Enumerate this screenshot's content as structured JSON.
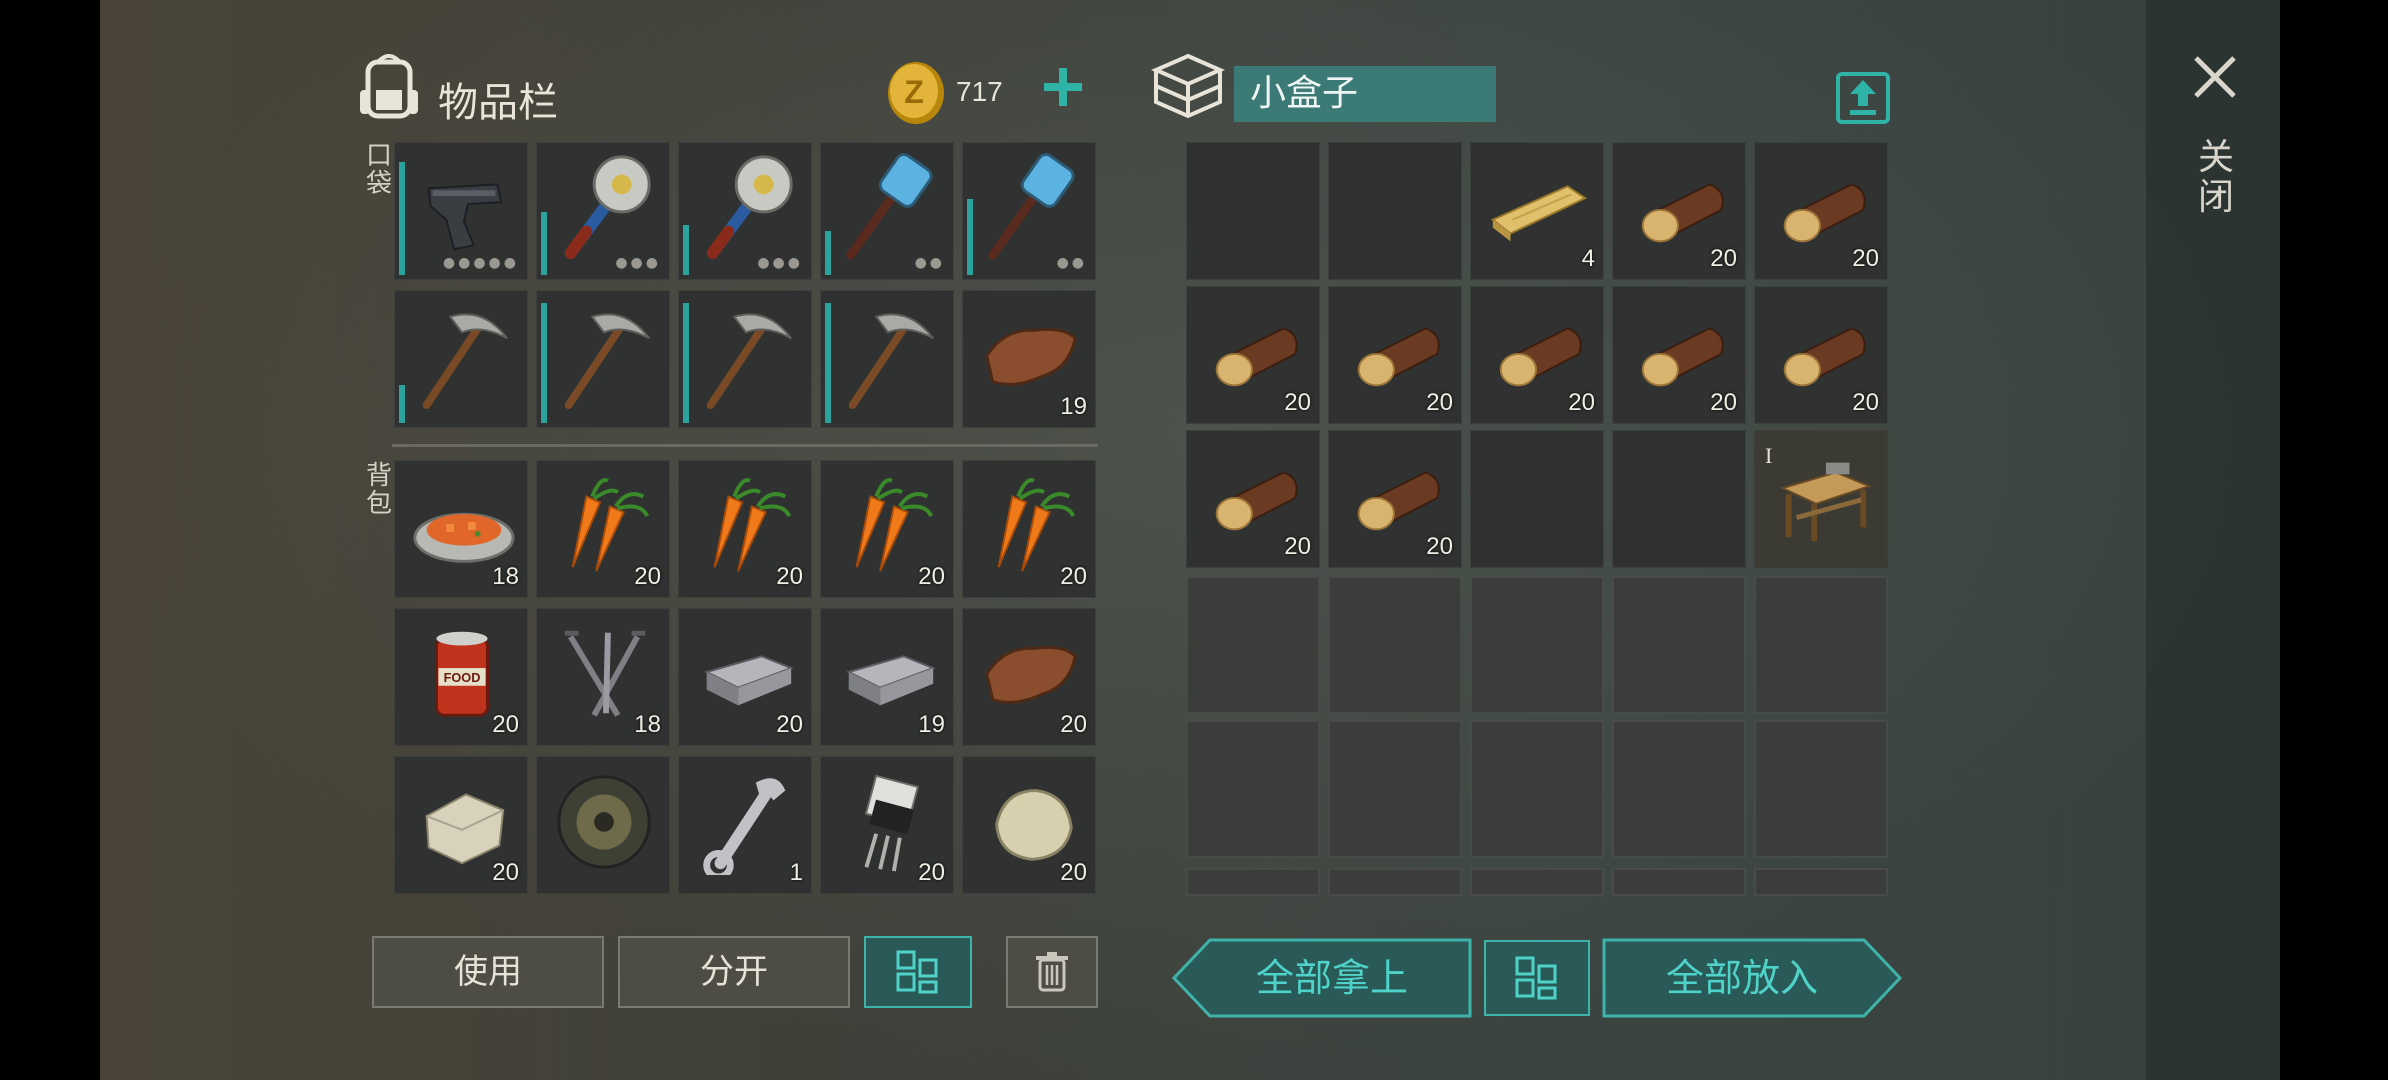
{
  "inventory": {
    "title": "物品栏",
    "pocket_label": "口袋",
    "backpack_label": "背包"
  },
  "currency": {
    "amount": "717"
  },
  "container": {
    "name": "小盒子"
  },
  "close_label": "关闭",
  "pocket": [
    {
      "icon": "pistol-icon",
      "qty": "",
      "dur": 0.9,
      "dots": "●●●●●"
    },
    {
      "icon": "saw-mace-icon",
      "qty": "",
      "dur": 0.5,
      "dots": "●●●"
    },
    {
      "icon": "saw-mace-icon",
      "qty": "",
      "dur": 0.4,
      "dots": "●●●"
    },
    {
      "icon": "sledgehammer-icon",
      "qty": "",
      "dur": 0.35,
      "dots": "●●"
    },
    {
      "icon": "sledgehammer-icon",
      "qty": "",
      "dur": 0.6,
      "dots": "●●"
    },
    {
      "icon": "pickaxe-icon",
      "qty": "",
      "dur": 0.3,
      "dots": ""
    },
    {
      "icon": "pickaxe-icon",
      "qty": "",
      "dur": 0.95,
      "dots": ""
    },
    {
      "icon": "pickaxe-icon",
      "qty": "",
      "dur": 0.95,
      "dots": ""
    },
    {
      "icon": "pickaxe-icon",
      "qty": "",
      "dur": 0.95,
      "dots": ""
    },
    {
      "icon": "leather-icon",
      "qty": "19",
      "dur": 0,
      "dots": ""
    }
  ],
  "backpack": [
    {
      "icon": "carrot-dish-icon",
      "qty": "18"
    },
    {
      "icon": "carrot-icon",
      "qty": "20"
    },
    {
      "icon": "carrot-icon",
      "qty": "20"
    },
    {
      "icon": "carrot-icon",
      "qty": "20"
    },
    {
      "icon": "carrot-icon",
      "qty": "20"
    },
    {
      "icon": "canned-food-icon",
      "qty": "20"
    },
    {
      "icon": "nails-icon",
      "qty": "18"
    },
    {
      "icon": "iron-bar-icon",
      "qty": "20"
    },
    {
      "icon": "iron-bar-icon",
      "qty": "19"
    },
    {
      "icon": "leather-icon",
      "qty": "20"
    },
    {
      "icon": "limestone-icon",
      "qty": "20"
    },
    {
      "icon": "wheel-icon",
      "qty": ""
    },
    {
      "icon": "wrench-icon",
      "qty": "1"
    },
    {
      "icon": "transistor-icon",
      "qty": "20"
    },
    {
      "icon": "stone-icon",
      "qty": "20"
    }
  ],
  "box": [
    {
      "icon": "",
      "qty": ""
    },
    {
      "icon": "",
      "qty": ""
    },
    {
      "icon": "plank-icon",
      "qty": "4"
    },
    {
      "icon": "log-icon",
      "qty": "20"
    },
    {
      "icon": "log-icon",
      "qty": "20"
    },
    {
      "icon": "log-icon",
      "qty": "20"
    },
    {
      "icon": "log-icon",
      "qty": "20"
    },
    {
      "icon": "log-icon",
      "qty": "20"
    },
    {
      "icon": "log-icon",
      "qty": "20"
    },
    {
      "icon": "log-icon",
      "qty": "20"
    },
    {
      "icon": "log-icon",
      "qty": "20"
    },
    {
      "icon": "log-icon",
      "qty": "20"
    },
    {
      "icon": "",
      "qty": ""
    },
    {
      "icon": "",
      "qty": ""
    },
    {
      "icon": "workbench-icon",
      "qty": "",
      "tier": "I"
    }
  ],
  "buttons": {
    "use": "使用",
    "split": "分开",
    "take_all": "全部拿上",
    "put_all": "全部放入"
  },
  "colors": {
    "accent": "#3fb2aa",
    "accent_text": "#4fd2c8",
    "slot_bg": "#2f3230",
    "durability": "#2aa39c"
  }
}
